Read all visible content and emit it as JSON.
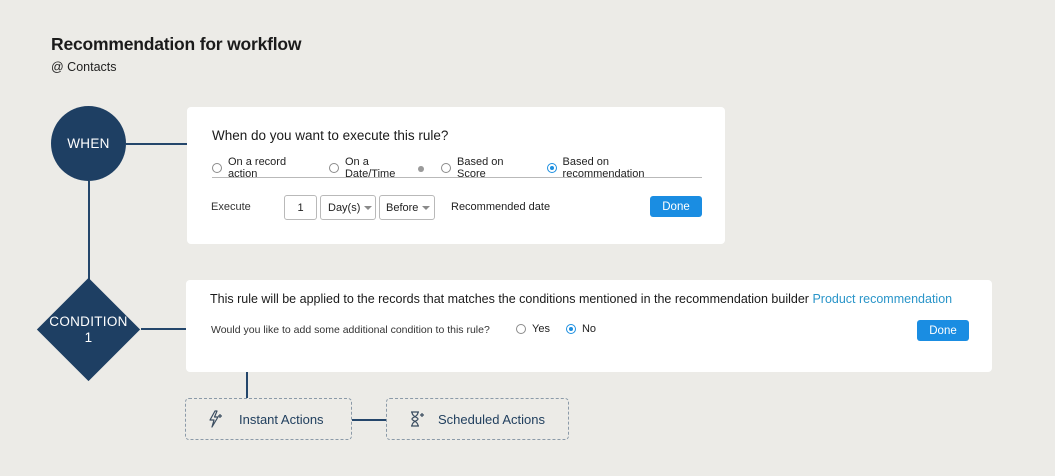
{
  "header": {
    "title": "Recommendation for workflow",
    "subtitle": "@ Contacts"
  },
  "when_node": {
    "label": "WHEN"
  },
  "condition_node": {
    "line1": "CONDITION",
    "line2": "1"
  },
  "when_card": {
    "question": "When do you want to execute this rule?",
    "options": [
      {
        "label": "On a record action",
        "selected": false
      },
      {
        "label": "On a Date/Time",
        "selected": false
      },
      {
        "label": "Based on Score",
        "selected": false
      },
      {
        "label": "Based on recommendation",
        "selected": true
      }
    ],
    "execute_label": "Execute",
    "number_value": "1",
    "unit_value": "Day(s)",
    "relation_value": "Before",
    "reference_text": "Recommended date",
    "done_label": "Done"
  },
  "condition_card": {
    "text": "This rule will be applied to the records that matches the conditions mentioned in the recommendation builder",
    "link": "Product recommendation",
    "question": "Would you like to add some additional condition to this rule?",
    "options": [
      {
        "label": "Yes",
        "selected": false
      },
      {
        "label": "No",
        "selected": true
      }
    ],
    "done_label": "Done"
  },
  "actions": {
    "instant_label": "Instant Actions",
    "scheduled_label": "Scheduled Actions",
    "instant_icon": "lightning-plus-icon",
    "scheduled_icon": "hourglass-plus-icon"
  },
  "colors": {
    "node": "#1e3f63",
    "accent": "#1a8de2",
    "link": "#2a95c9",
    "background": "#ecebe7"
  }
}
